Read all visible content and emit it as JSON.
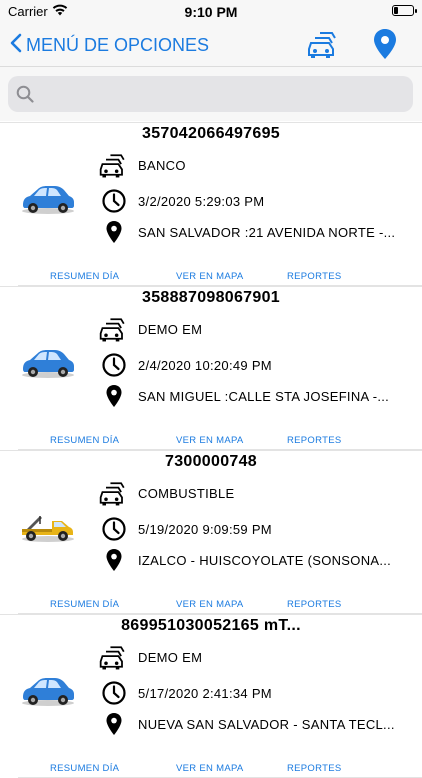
{
  "status_bar": {
    "carrier": "Carrier",
    "time": "9:10 PM"
  },
  "nav": {
    "back_label": "MENÚ DE OPCIONES"
  },
  "search": {
    "placeholder": ""
  },
  "links": {
    "summary": "RESUMEN DÍA",
    "map": "VER EN MAPA",
    "reports": "REPORTES"
  },
  "vehicles": [
    {
      "id": "357042066497695",
      "group": "BANCO",
      "datetime": "3/2/2020 5:29:03 PM",
      "location": "SAN SALVADOR :21 AVENIDA NORTE -...",
      "car_color": "blue"
    },
    {
      "id": "358887098067901",
      "group": "DEMO EM",
      "datetime": "2/4/2020 10:20:49 PM",
      "location": "SAN MIGUEL :CALLE STA JOSEFINA -...",
      "car_color": "blue"
    },
    {
      "id": "7300000748",
      "group": "COMBUSTIBLE",
      "datetime": "5/19/2020 9:09:59 PM",
      "location": "IZALCO - HUISCOYOLATE (SONSONA...",
      "car_color": "yellow"
    },
    {
      "id": "869951030052165 mT...",
      "group": "DEMO EM",
      "datetime": "5/17/2020 2:41:34 PM",
      "location": "NUEVA SAN SALVADOR - SANTA TECL...",
      "car_color": "blue"
    }
  ],
  "colors": {
    "accent": "#1b7be0",
    "blue_car": "#2f7fd8",
    "tow_truck": "#e8b418"
  }
}
